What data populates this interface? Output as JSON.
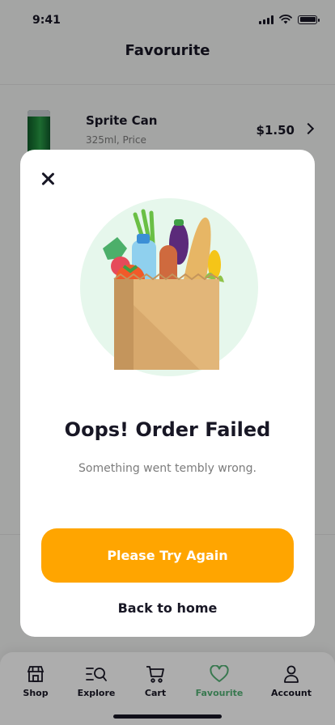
{
  "status_bar": {
    "time": "9:41"
  },
  "page": {
    "title": "Favorurite"
  },
  "product": {
    "name": "Sprite Can",
    "subtitle": "325ml, Price",
    "price": "$1.50"
  },
  "modal": {
    "title": "Oops! Order Failed",
    "message": "Something went tembly wrong.",
    "primary_button": "Please Try Again",
    "secondary_button": "Back to home"
  },
  "tabbar": {
    "items": [
      {
        "label": "Shop",
        "icon": "store-icon"
      },
      {
        "label": "Explore",
        "icon": "explore-icon"
      },
      {
        "label": "Cart",
        "icon": "cart-icon"
      },
      {
        "label": "Favourite",
        "icon": "heart-icon",
        "active": true
      },
      {
        "label": "Account",
        "icon": "user-icon"
      }
    ]
  },
  "colors": {
    "accent": "#53B175",
    "primary_button": "#FFA500",
    "text": "#181725",
    "muted": "#7C7C7C"
  }
}
